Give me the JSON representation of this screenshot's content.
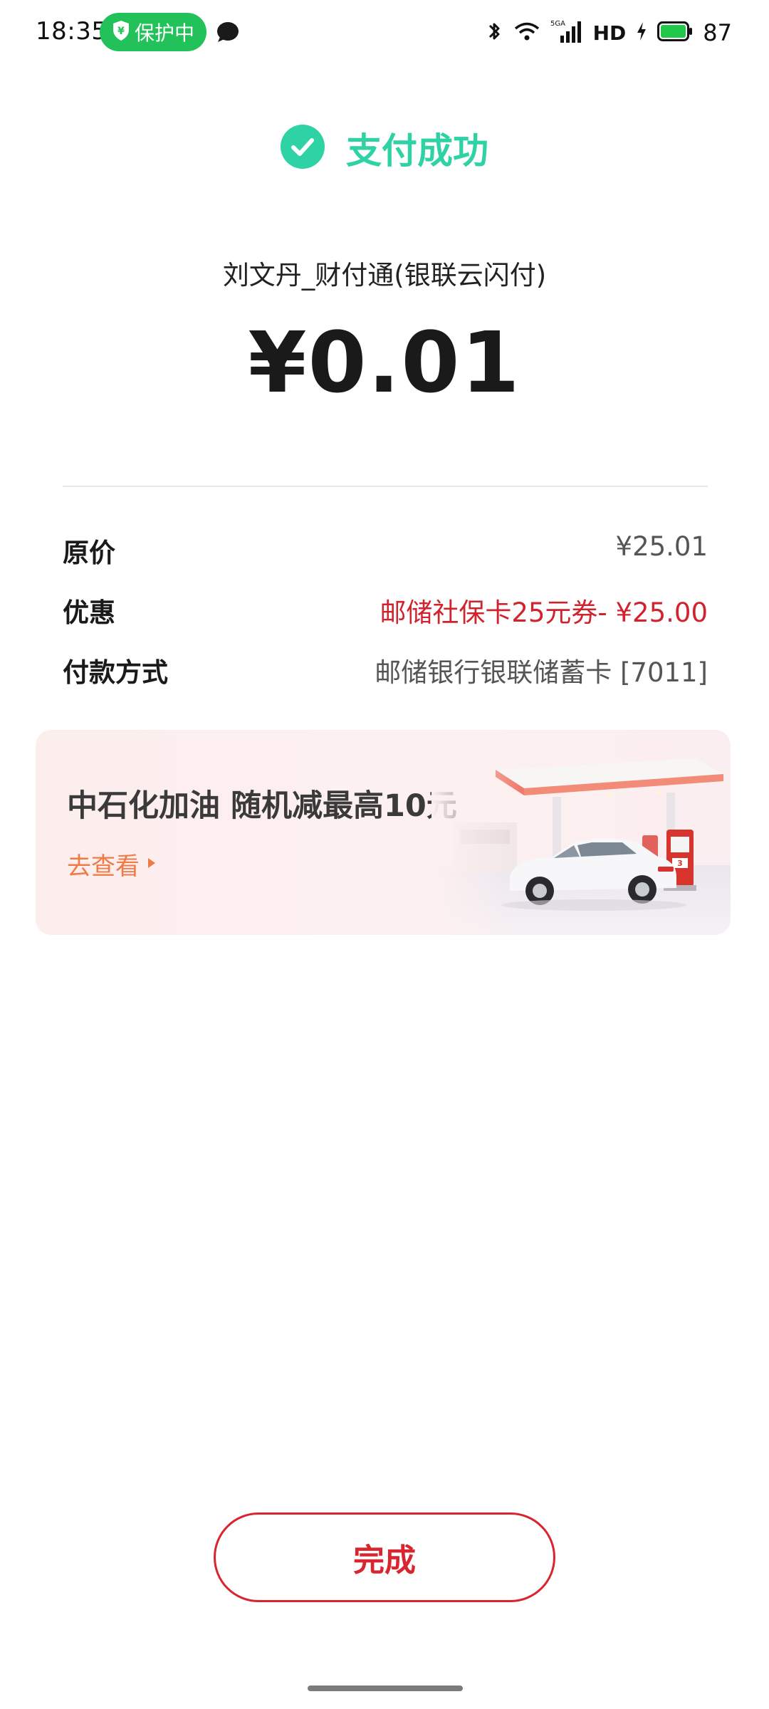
{
  "status_bar": {
    "time": "18:35",
    "protect_label": "保护中",
    "network": "5GA",
    "hd": "HD",
    "battery": "87"
  },
  "result": {
    "title": "支付成功",
    "merchant": "刘文丹_财付通(银联云闪付)",
    "amount": "¥0.01"
  },
  "details": [
    {
      "label": "原价",
      "value": "¥25.01"
    },
    {
      "label": "优惠",
      "value": "邮储社保卡25元券- ¥25.00"
    },
    {
      "label": "付款方式",
      "value": "邮储银行银联储蓄卡 [7011]"
    }
  ],
  "promo": {
    "title": "中石化加油 随机减最高10元",
    "link_label": "去查看"
  },
  "actions": {
    "done_label": "完成"
  },
  "colors": {
    "success": "#2fd2a5",
    "accent_red": "#d9252f",
    "promo_orange": "#f07a45",
    "protect_green": "#23c15a"
  }
}
